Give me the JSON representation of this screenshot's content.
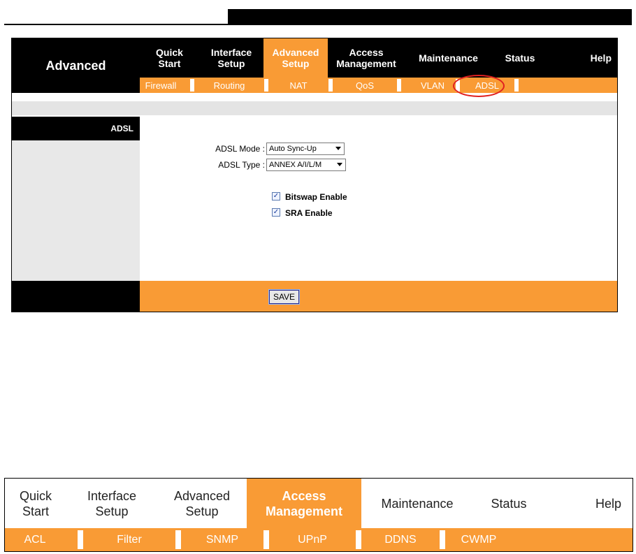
{
  "screen1": {
    "brand": "Advanced",
    "menu": [
      {
        "label": "Quick\nStart"
      },
      {
        "label": "Interface\nSetup"
      },
      {
        "label": "Advanced\nSetup"
      },
      {
        "label": "Access\nManagement"
      },
      {
        "label": "Maintenance"
      },
      {
        "label": "Status"
      },
      {
        "label": "Help"
      }
    ],
    "submenu": [
      "Firewall",
      "Routing",
      "NAT",
      "QoS",
      "VLAN",
      "ADSL"
    ],
    "section_title": "ADSL",
    "form": {
      "mode_label": "ADSL Mode :",
      "mode_value": "Auto Sync-Up",
      "type_label": "ADSL Type :",
      "type_value": "ANNEX A/I/L/M",
      "bitswap_label": "Bitswap Enable",
      "bitswap_checked": true,
      "sra_label": "SRA Enable",
      "sra_checked": true
    },
    "save_label": "SAVE"
  },
  "screen2": {
    "menu": [
      {
        "label": "Quick\nStart"
      },
      {
        "label": "Interface\nSetup"
      },
      {
        "label": "Advanced\nSetup"
      },
      {
        "label": "Access\nManagement"
      },
      {
        "label": "Maintenance"
      },
      {
        "label": "Status"
      },
      {
        "label": "Help"
      }
    ],
    "submenu": [
      "ACL",
      "Filter",
      "SNMP",
      "UPnP",
      "DDNS",
      "CWMP"
    ]
  },
  "colors": {
    "accent": "#f99b35",
    "highlight": "#e02020"
  }
}
